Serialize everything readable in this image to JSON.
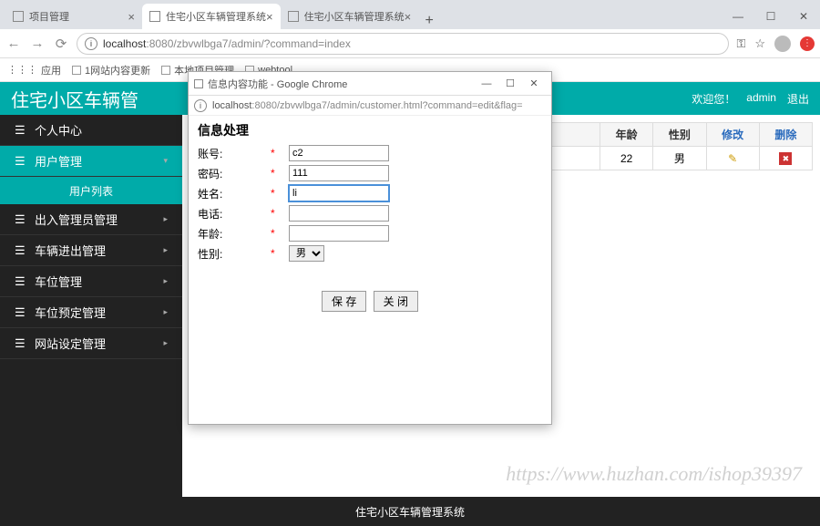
{
  "browser": {
    "tabs": [
      {
        "title": "项目管理"
      },
      {
        "title": "住宅小区车辆管理系统"
      },
      {
        "title": "住宅小区车辆管理系统"
      }
    ],
    "url_host": "localhost",
    "url_port": ":8080",
    "url_path": "/zbvwlbga7/admin/?command=index",
    "bookmarks": {
      "apps": "应用",
      "items": [
        "1网站内容更新",
        "本地项目管理",
        "webtool"
      ]
    }
  },
  "app": {
    "title": "住宅小区车辆管",
    "header_right": {
      "welcome": "欢迎您！",
      "admin": "admin",
      "logout": "退出"
    },
    "sidebar": [
      {
        "label": "个人中心"
      },
      {
        "label": "用户管理",
        "active": true,
        "sub": "用户列表"
      },
      {
        "label": "出入管理员管理"
      },
      {
        "label": "车辆进出管理"
      },
      {
        "label": "车位管理"
      },
      {
        "label": "车位预定管理"
      },
      {
        "label": "网站设定管理"
      }
    ],
    "table": {
      "headers": {
        "age": "年龄",
        "gender": "性别",
        "edit": "修改",
        "del": "删除"
      },
      "row": {
        "age": "22",
        "gender": "男"
      }
    },
    "footer": "住宅小区车辆管理系统"
  },
  "popup": {
    "window_title": "信息内容功能 - Google Chrome",
    "url_host": "localhost",
    "url_port": ":8080",
    "url_path": "/zbvwlbga7/admin/customer.html?command=edit&flag=",
    "heading": "信息处理",
    "fields": {
      "account": {
        "label": "账号:",
        "value": "c2"
      },
      "password": {
        "label": "密码:",
        "value": "111"
      },
      "name": {
        "label": "姓名:",
        "value": "li"
      },
      "phone": {
        "label": "电话:",
        "value": ""
      },
      "age": {
        "label": "年龄:",
        "value": ""
      },
      "gender": {
        "label": "性别:",
        "selected": "男"
      }
    },
    "buttons": {
      "save": "保  存",
      "close": "关  闭"
    }
  },
  "watermark": "https://www.huzhan.com/ishop39397"
}
